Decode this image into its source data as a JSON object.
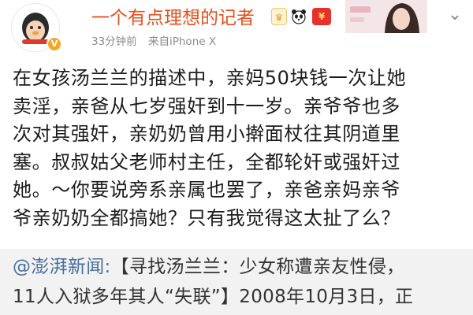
{
  "post": {
    "author": "一个有点理想的记者",
    "time": "33分钟前",
    "source": "来自iPhone X",
    "body_lines": [
      "在女孩汤兰兰的描述中，亲妈50块钱一次让她",
      "卖淫，亲爸从七岁强奸到十一岁。亲爷爷也多",
      "次对其强奸，亲奶奶曾用小擀面杖往其阴道里",
      "塞。叔叔姑父老师村主任，全都轮奸或强奸过",
      "她。～你要说旁系亲属也罢了，亲爸亲妈亲爷",
      "爷亲奶奶全都搞她？只有我觉得这太扯了么？"
    ]
  },
  "quote": {
    "source": "@澎湃新闻:",
    "line1_rest": "【寻找汤兰兰：少女称遭亲友性侵，",
    "line2": "11人入狱多年其人“失联”】2008年10月3日，正",
    "line3": ""
  },
  "icons": {
    "verify": "verified-badge",
    "crown": "crown-badge",
    "panda": "panda-badge",
    "red_envelope": "red-envelope-badge",
    "more": "chevron-down"
  },
  "colors": {
    "username": "#e8501e",
    "link": "#4a6e9e",
    "quote_bg": "#f2f2f2"
  }
}
